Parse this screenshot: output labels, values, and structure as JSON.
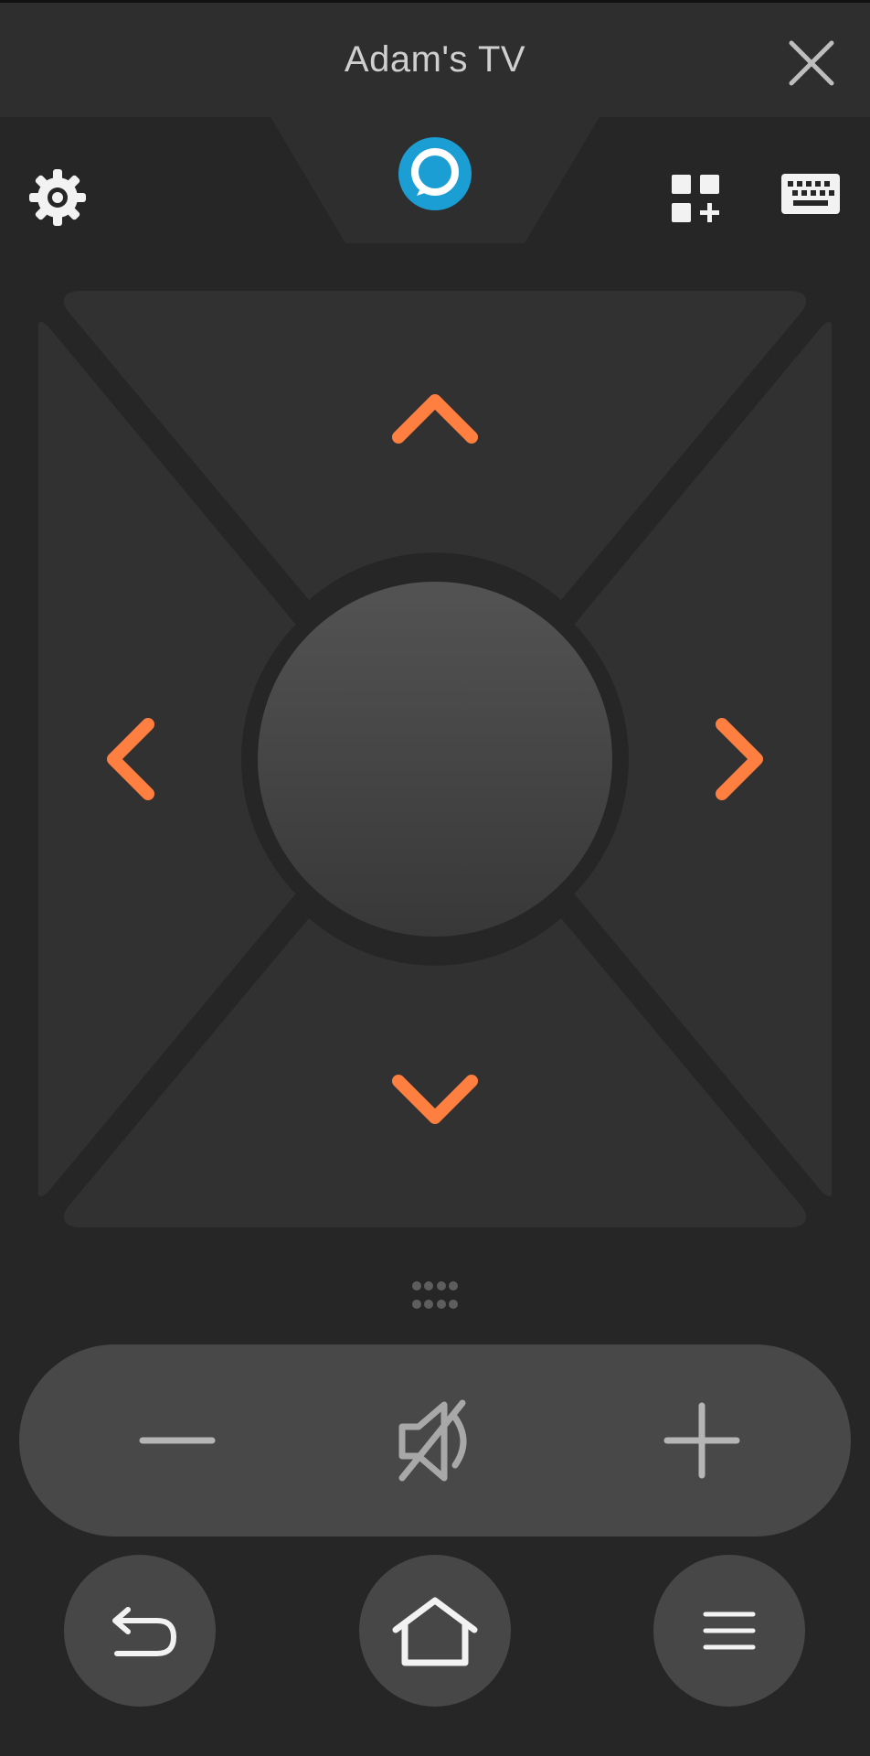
{
  "header": {
    "title": "Adam's TV"
  },
  "icons": {
    "close": "close-icon",
    "settings": "gear-icon",
    "alexa": "alexa-icon",
    "apps": "apps-add-icon",
    "keyboard": "keyboard-icon",
    "up": "chevron-up-icon",
    "down": "chevron-down-icon",
    "left": "chevron-left-icon",
    "right": "chevron-right-icon",
    "grip": "grip-dots-icon",
    "volume_down": "minus-icon",
    "mute": "mute-icon",
    "volume_up": "plus-icon",
    "back": "back-arrow-icon",
    "home": "home-icon",
    "menu": "hamburger-menu-icon"
  },
  "colors": {
    "accent": "#ff7f41",
    "alexa": "#1a9ed3",
    "background": "#262626",
    "pad": "#313131",
    "button": "#484848",
    "icon": "#e6e6e6"
  }
}
